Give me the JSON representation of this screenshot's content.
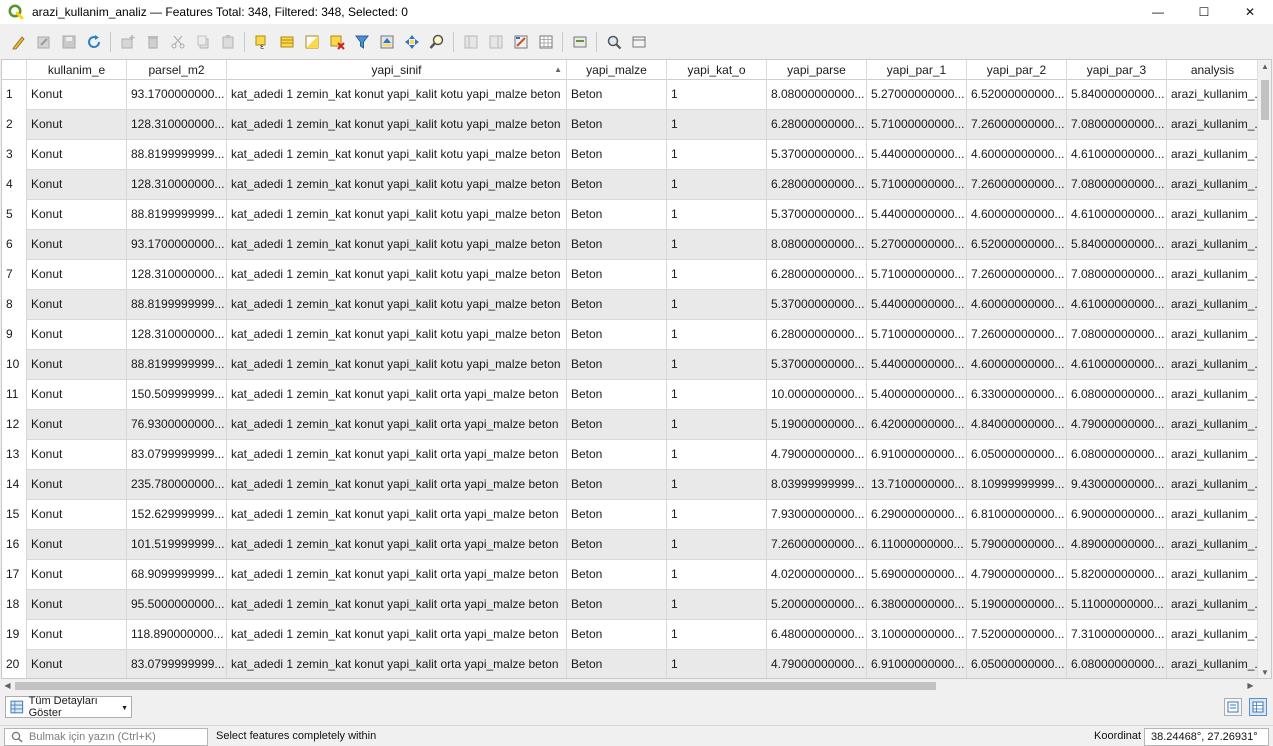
{
  "window": {
    "title": "arazi_kullanim_analiz — Features Total: 348, Filtered: 348, Selected: 0",
    "minimize_glyph": "—",
    "maximize_glyph": "☐",
    "close_glyph": "✕"
  },
  "colors": {
    "qgis_green": "#589632",
    "qgis_yellow": "#ffd700",
    "row_alt": "#e9e9e9",
    "grid": "#d8d8d8"
  },
  "toolbar": {
    "icons": [
      "toggle-editing-icon",
      "multi-edit-icon",
      "save-edits-icon",
      "reload-icon",
      "add-feature-icon",
      "delete-feature-icon",
      "cut-icon",
      "copy-icon",
      "paste-icon",
      "select-by-expression-icon",
      "select-all-icon",
      "invert-selection-icon",
      "deselect-all-icon",
      "filter-selected-icon",
      "move-selection-top-icon",
      "pan-to-selected-icon",
      "zoom-to-selected-icon",
      "new-field-icon",
      "delete-field-icon",
      "field-calculator-icon",
      "conditional-formatting-icon",
      "actions-icon",
      "dock-table-icon",
      "organize-columns-icon"
    ]
  },
  "table": {
    "columns": [
      "kullanim_e",
      "parsel_m2",
      "yapi_sinif",
      "yapi_malze",
      "yapi_kat_o",
      "yapi_parse",
      "yapi_par_1",
      "yapi_par_2",
      "yapi_par_3",
      "analysis"
    ],
    "sorted_column": "yapi_sinif",
    "sort_glyph": "▲",
    "rows": [
      {
        "n": "1",
        "c": [
          "Konut",
          "93.1700000000...",
          "kat_adedi 1 zemin_kat konut yapi_kalit kotu yapi_malze beton",
          "Beton",
          "1",
          "8.08000000000...",
          "5.27000000000...",
          "6.52000000000...",
          "5.84000000000...",
          "arazi_kullanim_..."
        ]
      },
      {
        "n": "2",
        "c": [
          "Konut",
          "128.310000000...",
          "kat_adedi 1 zemin_kat konut yapi_kalit kotu yapi_malze beton",
          "Beton",
          "1",
          "6.28000000000...",
          "5.71000000000...",
          "7.26000000000...",
          "7.08000000000...",
          "arazi_kullanim_..."
        ]
      },
      {
        "n": "3",
        "c": [
          "Konut",
          "88.8199999999...",
          "kat_adedi 1 zemin_kat konut yapi_kalit kotu yapi_malze beton",
          "Beton",
          "1",
          "5.37000000000...",
          "5.44000000000...",
          "4.60000000000...",
          "4.61000000000...",
          "arazi_kullanim_..."
        ]
      },
      {
        "n": "4",
        "c": [
          "Konut",
          "128.310000000...",
          "kat_adedi 1 zemin_kat konut yapi_kalit kotu yapi_malze beton",
          "Beton",
          "1",
          "6.28000000000...",
          "5.71000000000...",
          "7.26000000000...",
          "7.08000000000...",
          "arazi_kullanim_..."
        ]
      },
      {
        "n": "5",
        "c": [
          "Konut",
          "88.8199999999...",
          "kat_adedi 1 zemin_kat konut yapi_kalit kotu yapi_malze beton",
          "Beton",
          "1",
          "5.37000000000...",
          "5.44000000000...",
          "4.60000000000...",
          "4.61000000000...",
          "arazi_kullanim_..."
        ]
      },
      {
        "n": "6",
        "c": [
          "Konut",
          "93.1700000000...",
          "kat_adedi 1 zemin_kat konut yapi_kalit kotu yapi_malze beton",
          "Beton",
          "1",
          "8.08000000000...",
          "5.27000000000...",
          "6.52000000000...",
          "5.84000000000...",
          "arazi_kullanim_..."
        ]
      },
      {
        "n": "7",
        "c": [
          "Konut",
          "128.310000000...",
          "kat_adedi 1 zemin_kat konut yapi_kalit kotu yapi_malze beton",
          "Beton",
          "1",
          "6.28000000000...",
          "5.71000000000...",
          "7.26000000000...",
          "7.08000000000...",
          "arazi_kullanim_..."
        ]
      },
      {
        "n": "8",
        "c": [
          "Konut",
          "88.8199999999...",
          "kat_adedi 1 zemin_kat konut yapi_kalit kotu yapi_malze beton",
          "Beton",
          "1",
          "5.37000000000...",
          "5.44000000000...",
          "4.60000000000...",
          "4.61000000000...",
          "arazi_kullanim_..."
        ]
      },
      {
        "n": "9",
        "c": [
          "Konut",
          "128.310000000...",
          "kat_adedi 1 zemin_kat konut yapi_kalit kotu yapi_malze beton",
          "Beton",
          "1",
          "6.28000000000...",
          "5.71000000000...",
          "7.26000000000...",
          "7.08000000000...",
          "arazi_kullanim_..."
        ]
      },
      {
        "n": "10",
        "c": [
          "Konut",
          "88.8199999999...",
          "kat_adedi 1 zemin_kat konut yapi_kalit kotu yapi_malze beton",
          "Beton",
          "1",
          "5.37000000000...",
          "5.44000000000...",
          "4.60000000000...",
          "4.61000000000...",
          "arazi_kullanim_..."
        ]
      },
      {
        "n": "11",
        "c": [
          "Konut",
          "150.509999999...",
          "kat_adedi 1 zemin_kat konut yapi_kalit orta yapi_malze beton",
          "Beton",
          "1",
          "10.0000000000...",
          "5.40000000000...",
          "6.33000000000...",
          "6.08000000000...",
          "arazi_kullanim_..."
        ]
      },
      {
        "n": "12",
        "c": [
          "Konut",
          "76.9300000000...",
          "kat_adedi 1 zemin_kat konut yapi_kalit orta yapi_malze beton",
          "Beton",
          "1",
          "5.19000000000...",
          "6.42000000000...",
          "4.84000000000...",
          "4.79000000000...",
          "arazi_kullanim_..."
        ]
      },
      {
        "n": "13",
        "c": [
          "Konut",
          "83.0799999999...",
          "kat_adedi 1 zemin_kat konut yapi_kalit orta yapi_malze beton",
          "Beton",
          "1",
          "4.79000000000...",
          "6.91000000000...",
          "6.05000000000...",
          "6.08000000000...",
          "arazi_kullanim_..."
        ]
      },
      {
        "n": "14",
        "c": [
          "Konut",
          "235.780000000...",
          "kat_adedi 1 zemin_kat konut yapi_kalit orta yapi_malze beton",
          "Beton",
          "1",
          "8.03999999999...",
          "13.7100000000...",
          "8.10999999999...",
          "9.43000000000...",
          "arazi_kullanim_..."
        ]
      },
      {
        "n": "15",
        "c": [
          "Konut",
          "152.629999999...",
          "kat_adedi 1 zemin_kat konut yapi_kalit orta yapi_malze beton",
          "Beton",
          "1",
          "7.93000000000...",
          "6.29000000000...",
          "6.81000000000...",
          "6.90000000000...",
          "arazi_kullanim_..."
        ]
      },
      {
        "n": "16",
        "c": [
          "Konut",
          "101.519999999...",
          "kat_adedi 1 zemin_kat konut yapi_kalit orta yapi_malze beton",
          "Beton",
          "1",
          "7.26000000000...",
          "6.11000000000...",
          "5.79000000000...",
          "4.89000000000...",
          "arazi_kullanim_..."
        ]
      },
      {
        "n": "17",
        "c": [
          "Konut",
          "68.9099999999...",
          "kat_adedi 1 zemin_kat konut yapi_kalit orta yapi_malze beton",
          "Beton",
          "1",
          "4.02000000000...",
          "5.69000000000...",
          "4.79000000000...",
          "5.82000000000...",
          "arazi_kullanim_..."
        ]
      },
      {
        "n": "18",
        "c": [
          "Konut",
          "95.5000000000...",
          "kat_adedi 1 zemin_kat konut yapi_kalit orta yapi_malze beton",
          "Beton",
          "1",
          "5.20000000000...",
          "6.38000000000...",
          "5.19000000000...",
          "5.11000000000...",
          "arazi_kullanim_..."
        ]
      },
      {
        "n": "19",
        "c": [
          "Konut",
          "118.890000000...",
          "kat_adedi 1 zemin_kat konut yapi_kalit orta yapi_malze beton",
          "Beton",
          "1",
          "6.48000000000...",
          "3.10000000000...",
          "7.52000000000...",
          "7.31000000000...",
          "arazi_kullanim_..."
        ]
      },
      {
        "n": "20",
        "c": [
          "Konut",
          "83.0799999999...",
          "kat_adedi 1 zemin_kat konut yapi_kalit orta yapi_malze beton",
          "Beton",
          "1",
          "4.79000000000...",
          "6.91000000000...",
          "6.05000000000...",
          "6.08000000000...",
          "arazi_kullanim_..."
        ]
      }
    ]
  },
  "bottom": {
    "detail_button_label": "Tüm Detayları Göster"
  },
  "status": {
    "search_placeholder": "Bulmak için yazın (Ctrl+K)",
    "message": "Select features completely within",
    "coord_label": "Koordinat",
    "coord_value": "38.24468°, 27.26931°"
  }
}
